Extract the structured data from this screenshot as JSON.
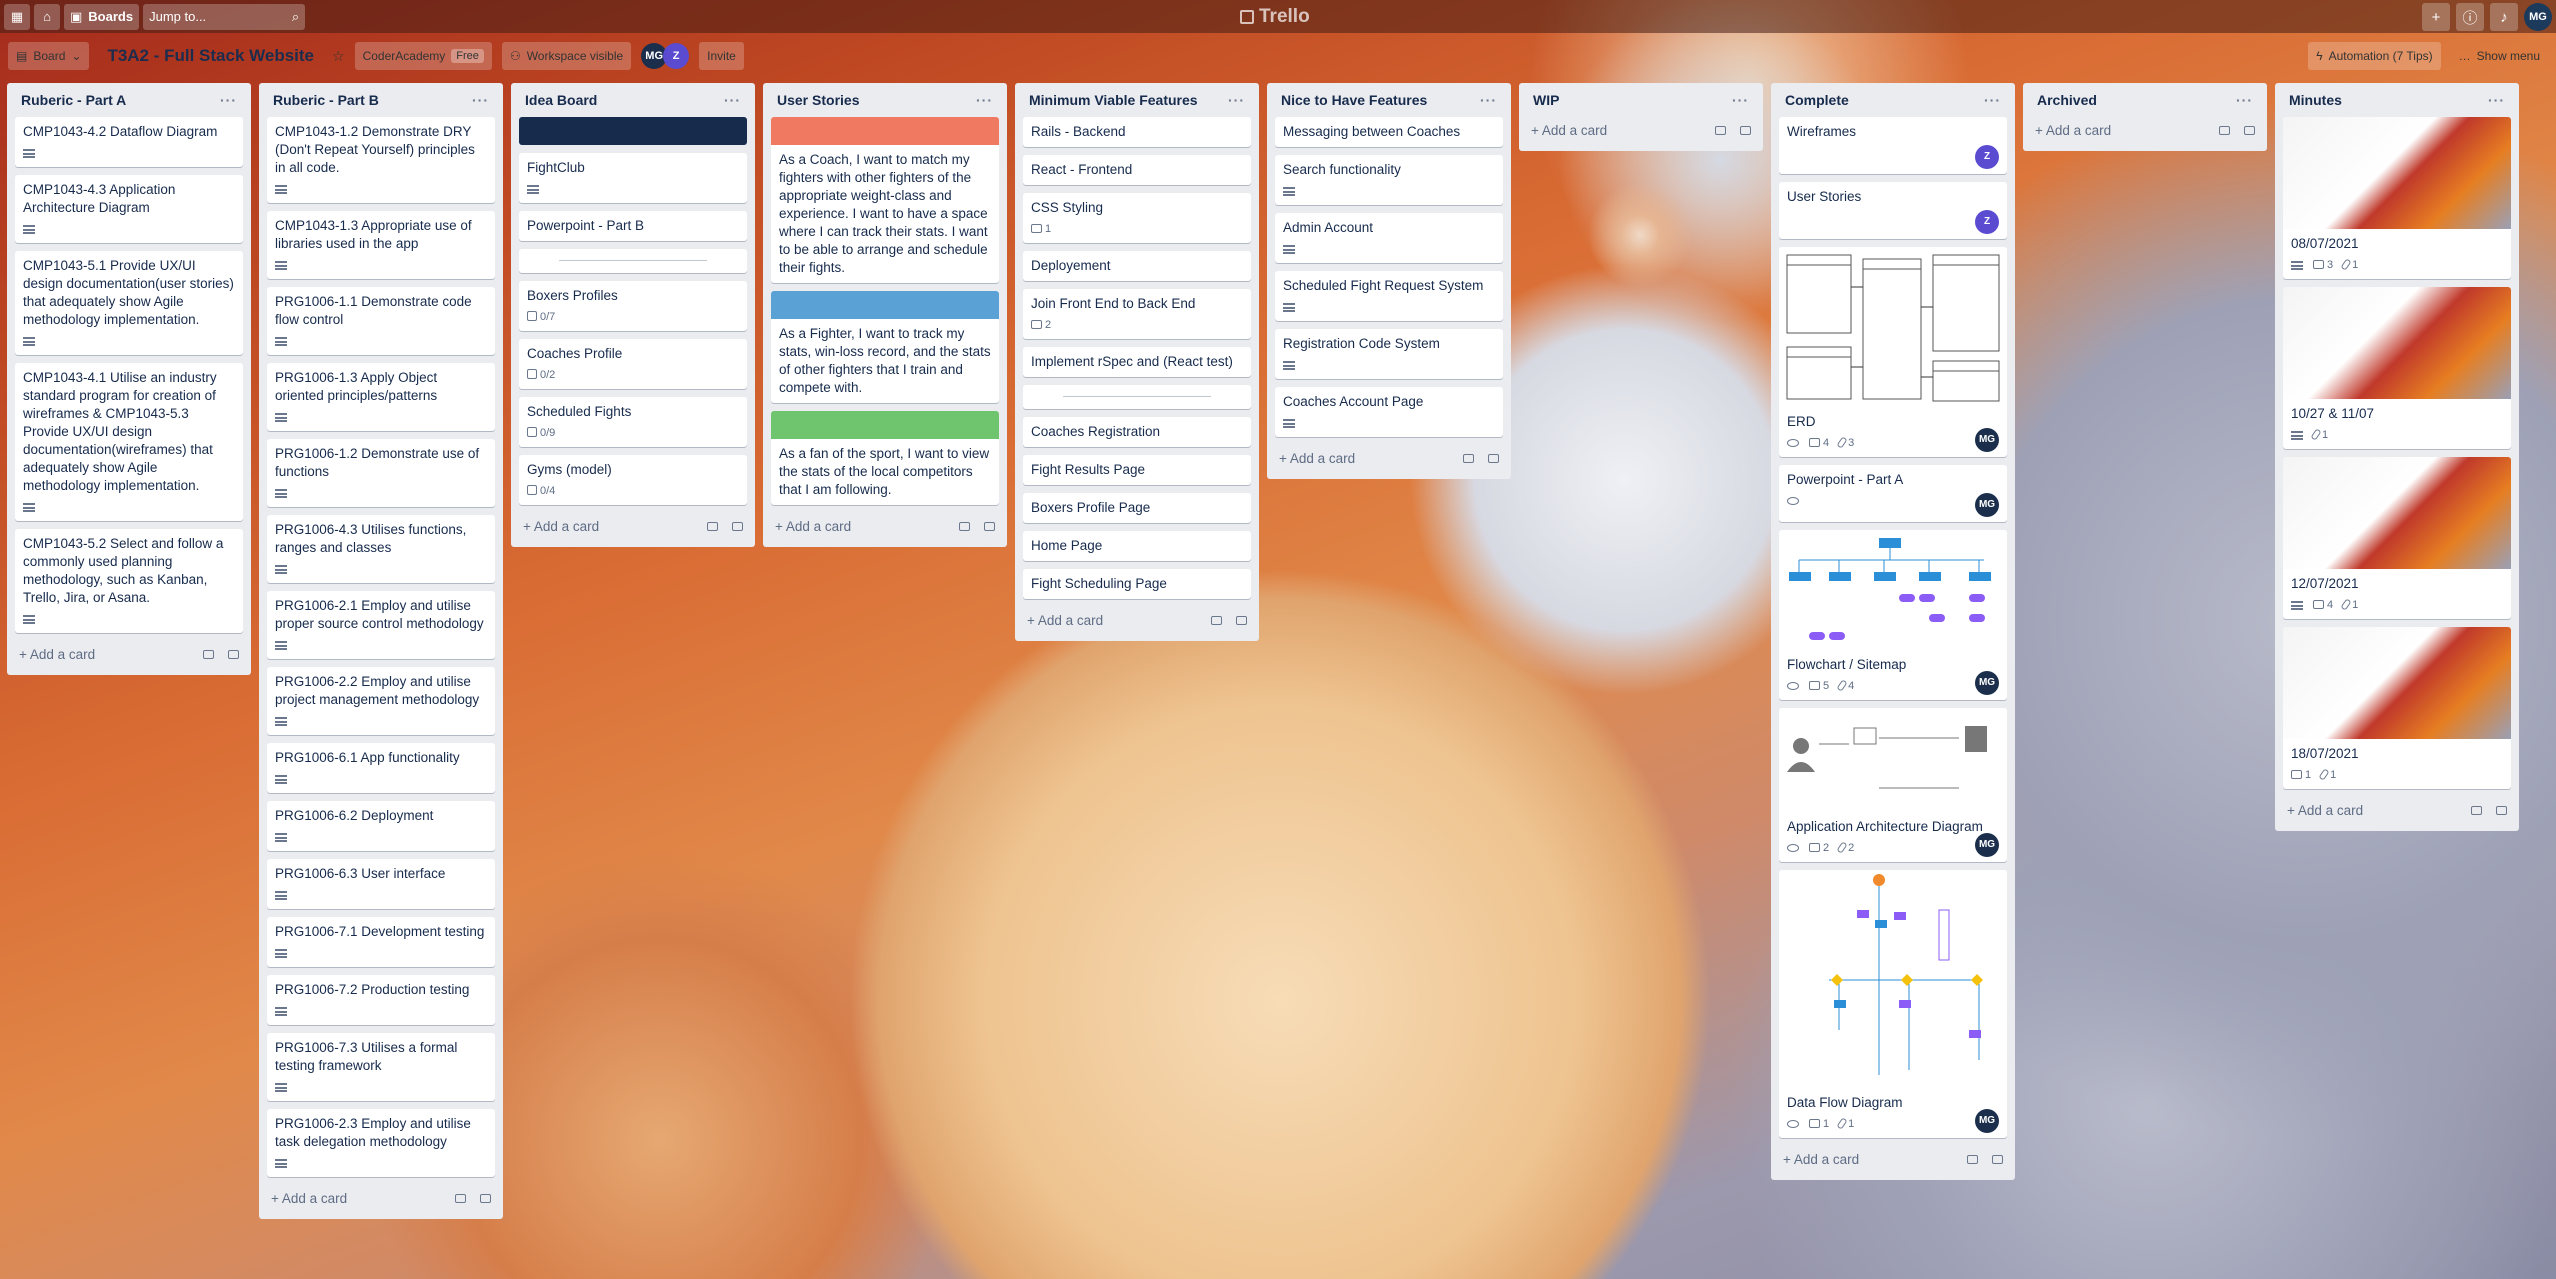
{
  "topbar": {
    "boards_label": "Boards",
    "jump_placeholder": "Jump to...",
    "logo": "Trello",
    "user_initials": "MG"
  },
  "boardbar": {
    "view_label": "Board",
    "title": "T3A2 - Full Stack Website",
    "workspace": "CoderAcademy",
    "plan": "Free",
    "visibility": "Workspace visible",
    "invite": "Invite",
    "automation": "Automation (7 Tips)",
    "show_menu": "Show menu"
  },
  "members": {
    "mg": "MG",
    "z": "Z"
  },
  "add_card": "Add a card",
  "lists": {
    "l0": {
      "title": "Ruberic - Part A",
      "cards": [
        "CMP1043-4.2 Dataflow Diagram",
        "CMP1043-4.3 Application Architecture Diagram",
        "CMP1043-5.1 Provide UX/UI design documentation(user stories) that adequately show Agile methodology implementation.",
        "CMP1043-4.1 Utilise an industry standard program for creation of wireframes & CMP1043-5.3 Provide UX/UI design documentation(wireframes) that adequately show Agile methodology implementation.",
        "CMP1043-5.2 Select and follow a commonly used planning methodology, such as Kanban, Trello, Jira, or Asana."
      ]
    },
    "l1": {
      "title": "Ruberic - Part B",
      "cards": [
        "CMP1043-1.2 Demonstrate DRY (Don't Repeat Yourself) principles in all code.",
        "CMP1043-1.3 Appropriate use of libraries used in the app",
        "PRG1006-1.1 Demonstrate code flow control",
        "PRG1006-1.3 Apply Object oriented principles/patterns",
        "PRG1006-1.2 Demonstrate use of functions",
        "PRG1006-4.3 Utilises functions, ranges and classes",
        "PRG1006-2.1 Employ and utilise proper source control methodology",
        "PRG1006-2.2 Employ and utilise project management methodology",
        "PRG1006-6.1 App functionality",
        "PRG1006-6.2 Deployment",
        "PRG1006-6.3 User interface",
        "PRG1006-7.1 Development testing",
        "PRG1006-7.2 Production testing",
        "PRG1006-7.3 Utilises a formal testing framework",
        "PRG1006-2.3 Employ and utilise task delegation methodology"
      ]
    },
    "l2": {
      "title": "Idea Board",
      "cards": [
        "FightClub",
        "Powerpoint - Part B",
        "Boxers Profiles",
        "Coaches Profile",
        "Scheduled Fights",
        "Gyms (model)"
      ],
      "checks": [
        "0/7",
        "0/2",
        "0/9",
        "0/4"
      ]
    },
    "l3": {
      "title": "User Stories",
      "cards": [
        "As a Coach, I want to match my fighters with other fighters of the appropriate weight-class and experience. I want to have a space where I can track their stats. I want to be able to arrange and schedule their fights.",
        "As a Fighter, I want to track my stats, win-loss record, and the stats of other fighters that I train and compete with.",
        "As a fan of the sport, I want to view the stats of the local competitors that I am following."
      ]
    },
    "l4": {
      "title": "Minimum Viable Features",
      "cards": [
        "Rails - Backend",
        "React - Frontend",
        "CSS Styling",
        "Deployement",
        "Join Front End to Back End",
        "Implement rSpec and (React test)",
        "Coaches Registration",
        "Fight Results Page",
        "Boxers Profile Page",
        "Home Page",
        "Fight Scheduling Page"
      ],
      "counts": [
        "1",
        "2"
      ]
    },
    "l5": {
      "title": "Nice to Have Features",
      "cards": [
        "Messaging between Coaches",
        "Search functionality",
        "Admin Account",
        "Scheduled Fight Request System",
        "Registration Code System",
        "Coaches Account Page"
      ]
    },
    "l6": {
      "title": "WIP"
    },
    "l7": {
      "title": "Complete",
      "cards": [
        "Wireframes",
        "User Stories",
        "ERD",
        "Powerpoint - Part A",
        "Flowchart / Sitemap",
        "Application Architecture Diagram",
        "Data Flow Diagram"
      ],
      "counts": [
        "4",
        "3",
        "5",
        "4",
        "2",
        "2",
        "1",
        "1"
      ]
    },
    "l8": {
      "title": "Archived"
    },
    "l9": {
      "title": "Minutes",
      "cards": [
        "08/07/2021",
        "10/27 & 11/07",
        "12/07/2021",
        "18/07/2021"
      ],
      "counts": [
        "3",
        "1",
        "1",
        "4",
        "1",
        "1",
        "1"
      ]
    }
  },
  "colors": {
    "cover_navy": "#172b4d",
    "cover_red": "#f07a61",
    "cover_blue": "#5aa1d6",
    "cover_green": "#6fc56e",
    "member_z": "#5a4bd1",
    "member_mg": "#1b2f4d"
  }
}
